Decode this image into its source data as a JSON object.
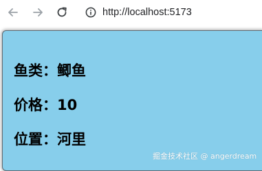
{
  "browser": {
    "url": "http://localhost:5173",
    "icons": {
      "back": "arrow-left-icon",
      "forward": "arrow-right-icon",
      "reload": "reload-icon",
      "site_info": "info-icon"
    }
  },
  "page": {
    "background_color": "#87ceeb",
    "rows": [
      {
        "label": "鱼类",
        "separator": "：",
        "value": "鲫鱼"
      },
      {
        "label": "价格",
        "separator": "：",
        "value": "10"
      },
      {
        "label": "位置",
        "separator": "：",
        "value": "河里"
      }
    ]
  },
  "watermark": "掘金技术社区 @ angerdream"
}
